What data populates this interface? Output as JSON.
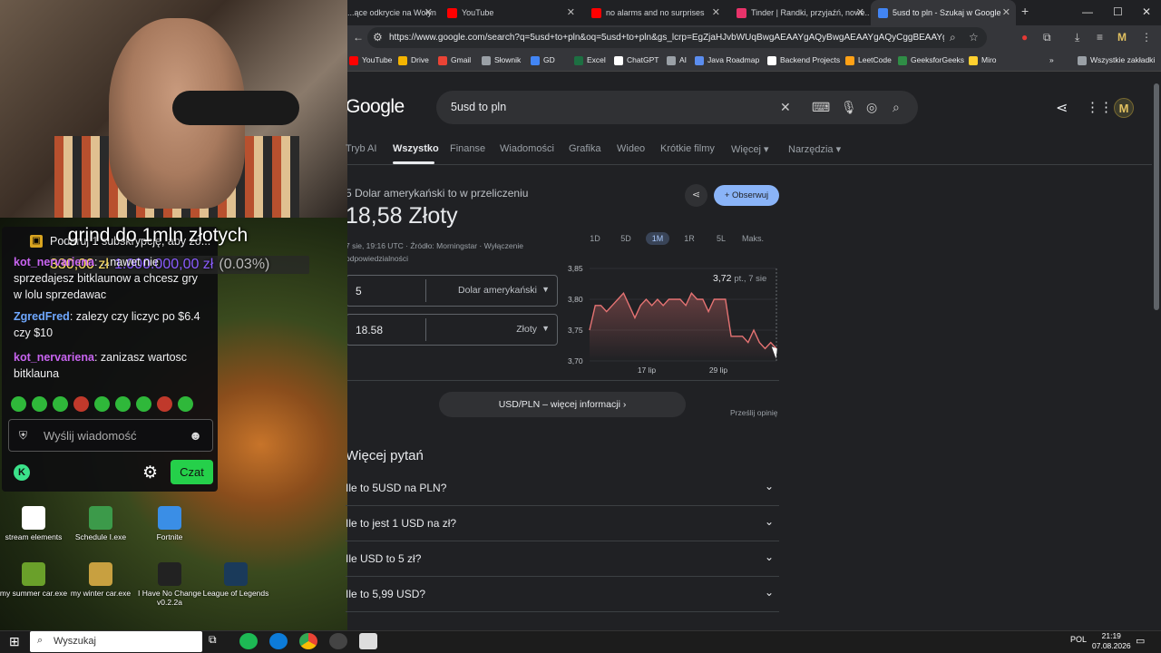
{
  "overlay": {
    "title": "grind do 1mln złotych",
    "goal": {
      "current": "330,00 zł",
      "target": "1.000.000,00 zł",
      "percent": "(0.03%)"
    },
    "chat": {
      "sub_text": "Podaruj 1 subskrypcję, aby zo...",
      "messages": [
        {
          "user": "kot_nervariena",
          "text": ": ...nawet nie sprzedajesz bitklaunow a chcesz gry w lolu sprzedawac"
        },
        {
          "user": "ZgredFred",
          "text": ": zalezy czy liczyc po $6.4 czy $10"
        },
        {
          "user": "kot_nervariena",
          "text": ": zanizasz wartosc bitklauna"
        }
      ],
      "placeholder": "Wyślij wiadomość",
      "send_label": "Czat"
    },
    "desktop_icons": [
      {
        "label": "stream elements",
        "color": "#ffffff"
      },
      {
        "label": "Schedule I.exe",
        "color": "#3c9a4a"
      },
      {
        "label": "Fortnite",
        "color": "#3a8ee6"
      },
      {
        "label": "my summer car.exe",
        "color": "#6aa02a"
      },
      {
        "label": "my winter car.exe",
        "color": "#c8a040"
      },
      {
        "label": "I Have No Change v0.2.2a",
        "color": "#222222"
      },
      {
        "label": "League of Legends",
        "color": "#1a3a5a"
      }
    ]
  },
  "taskbar": {
    "search": "Wyszukaj",
    "lang": "POL",
    "time": "21:19",
    "date": "07.08.2026"
  },
  "browser": {
    "tabs": [
      {
        "label": "...ące odkrycie na Wołyn",
        "favicon": "#888888"
      },
      {
        "label": "YouTube",
        "favicon": "#ff0000"
      },
      {
        "label": "no alarms and no surprises",
        "favicon": "#ff0000"
      },
      {
        "label": "Tinder | Randki, przyjaźń, nowe...",
        "favicon": "#e8336a"
      },
      {
        "label": "5usd to pln - Szukaj w Google",
        "favicon": "#4285f4"
      }
    ],
    "url": "https://www.google.com/search?q=5usd+to+pln&oq=5usd+to+pln&gs_lcrp=EgZjaHJvbWUqBwgAEAAYgAQyBwgAEAAYgAQyCggBEAAYgAQyCggBEAAYChgWGB...",
    "bookmarks": [
      {
        "label": "YouTube",
        "color": "#ff0000"
      },
      {
        "label": "Drive",
        "color": "#f4b400"
      },
      {
        "label": "Gmail",
        "color": "#ea4335"
      },
      {
        "label": "Słownik",
        "color": "#9aa0a6"
      },
      {
        "label": "GD",
        "color": "#4285f4"
      },
      {
        "label": "Excel",
        "color": "#1d6f42"
      },
      {
        "label": "ChatGPT",
        "color": "#ffffff"
      },
      {
        "label": "AI",
        "color": "#9aa0a6"
      },
      {
        "label": "Java Roadmap",
        "color": "#5b8def"
      },
      {
        "label": "Backend Projects",
        "color": "#ffffff"
      },
      {
        "label": "LeetCode",
        "color": "#ffa116"
      },
      {
        "label": "GeeksforGeeks",
        "color": "#2f8d46"
      },
      {
        "label": "Miro",
        "color": "#ffd02f"
      }
    ],
    "bookmarks_all": "Wszystkie zakładki"
  },
  "google": {
    "logo": "Google",
    "query": "5usd to pln",
    "nav": [
      "Tryb AI",
      "Wszystko",
      "Finanse",
      "Wiadomości",
      "Grafika",
      "Wideo",
      "Krótkie filmy",
      "Więcej ▾",
      "Narzędzia ▾"
    ],
    "conversion_label": "5 Dolar amerykański to w przeliczeniu",
    "result": "18,58 Złoty",
    "meta": "7 sie, 19:16 UTC · Źródło: Morningstar · Wyłączenie odpowiedzialności",
    "follow": "Obserwuj",
    "ranges": [
      "1D",
      "5D",
      "1M",
      "1R",
      "5L",
      "Maks."
    ],
    "from": {
      "value": "5",
      "currency": "Dolar amerykański"
    },
    "to": {
      "value": "18.58",
      "currency": "Złoty"
    },
    "tooltip": {
      "value": "3,72",
      "date": "pt., 7 sie"
    },
    "more_info": "USD/PLN – więcej informacji  ›",
    "feedback": "Prześlij opinię",
    "paa_title": "Więcej pytań",
    "paa": [
      "Ile to 5USD na PLN?",
      "Ile to jest 1 USD na zł?",
      "Ile USD to 5 zł?",
      "Ile to 5,99 USD?"
    ]
  },
  "chart_data": {
    "type": "area",
    "x_tick_labels": [
      "17 lip",
      "29 lip"
    ],
    "y_ticks": [
      "3,85",
      "3,80",
      "3,75",
      "3,70"
    ],
    "ylim": [
      3.7,
      3.85
    ],
    "values": [
      3.75,
      3.79,
      3.79,
      3.78,
      3.79,
      3.8,
      3.81,
      3.79,
      3.77,
      3.79,
      3.8,
      3.79,
      3.8,
      3.79,
      3.8,
      3.8,
      3.8,
      3.79,
      3.81,
      3.8,
      3.8,
      3.78,
      3.8,
      3.8,
      3.8,
      3.74,
      3.74,
      3.74,
      3.73,
      3.75,
      3.73,
      3.72,
      3.73,
      3.72
    ],
    "color": "#e57373"
  }
}
